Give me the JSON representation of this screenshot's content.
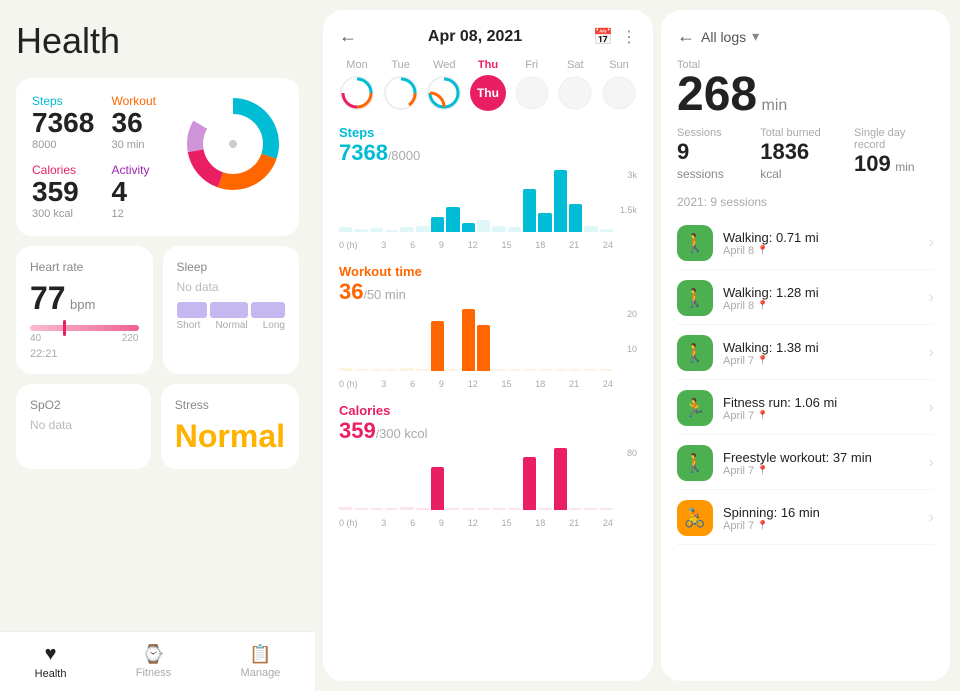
{
  "app": {
    "title": "Health"
  },
  "stats": {
    "steps_label": "Steps",
    "steps_value": "7368",
    "steps_goal": "8000",
    "workout_label": "Workout",
    "workout_value": "36",
    "workout_unit": "30 min",
    "calories_label": "Calories",
    "calories_value": "359",
    "calories_goal": "300 kcal",
    "activity_label": "Activity",
    "activity_value": "4",
    "activity_goal": "12"
  },
  "heart_rate": {
    "title": "Heart rate",
    "value": "77",
    "unit": "bpm",
    "min": "40",
    "max": "220",
    "time": "22:21"
  },
  "sleep": {
    "title": "Sleep",
    "no_data": "No data",
    "labels": [
      "Short",
      "Normal",
      "Long"
    ]
  },
  "spo2": {
    "title": "SpO2",
    "no_data": "No data"
  },
  "stress": {
    "title": "Stress",
    "value": "Normal"
  },
  "nav": {
    "items": [
      {
        "label": "Health",
        "active": true
      },
      {
        "label": "Fitness",
        "active": false
      },
      {
        "label": "Manage",
        "active": false
      }
    ]
  },
  "date_nav": {
    "date": "Apr 08, 2021",
    "days": [
      "Mon",
      "Tue",
      "Wed",
      "Thu",
      "Fri",
      "Sat",
      "Sun"
    ],
    "active_day": "Thu"
  },
  "steps_chart": {
    "title": "Steps",
    "value": "7368",
    "goal": "8000",
    "max_label": "3k",
    "mid_label": "1.5k",
    "x_labels": [
      "0 (h)",
      "3",
      "6",
      "9",
      "12",
      "15",
      "18",
      "21",
      "24"
    ]
  },
  "workout_chart": {
    "title": "Workout time",
    "value": "36",
    "goal": "50 min",
    "max_label": "20",
    "mid_label": "10",
    "x_labels": [
      "0 (h)",
      "3",
      "6",
      "9",
      "12",
      "15",
      "18",
      "21",
      "24"
    ]
  },
  "calories_chart": {
    "title": "Calories",
    "value": "359",
    "goal": "300 kcol",
    "max_label": "80",
    "x_labels": [
      "0 (h)",
      "3",
      "6",
      "9",
      "12",
      "15",
      "18",
      "21",
      "24"
    ]
  },
  "all_logs": {
    "back_label": "All logs",
    "total_label": "Total",
    "total_value": "268",
    "total_unit": "min",
    "sessions_label": "Sessions",
    "sessions_value": "9",
    "sessions_unit": "sessions",
    "total_burned_label": "Total burned",
    "total_burned_value": "1836",
    "total_burned_unit": "kcal",
    "single_day_label": "Single day record",
    "single_day_value": "109",
    "single_day_unit": "min",
    "year_sessions": "2021: 9 sessions",
    "activities": [
      {
        "name": "Walking: 0.71 mi",
        "date": "April 8",
        "type": "walking",
        "color": "green"
      },
      {
        "name": "Walking: 1.28 mi",
        "date": "April 8",
        "type": "walking",
        "color": "green"
      },
      {
        "name": "Walking: 1.38 mi",
        "date": "April 7",
        "type": "walking",
        "color": "green"
      },
      {
        "name": "Fitness run: 1.06 mi",
        "date": "April 7",
        "type": "running",
        "color": "green"
      },
      {
        "name": "Freestyle workout: 37 min",
        "date": "April 7",
        "type": "workout",
        "color": "green"
      },
      {
        "name": "Spinning: 16 min",
        "date": "April 7",
        "type": "spinning",
        "color": "orange"
      }
    ]
  }
}
